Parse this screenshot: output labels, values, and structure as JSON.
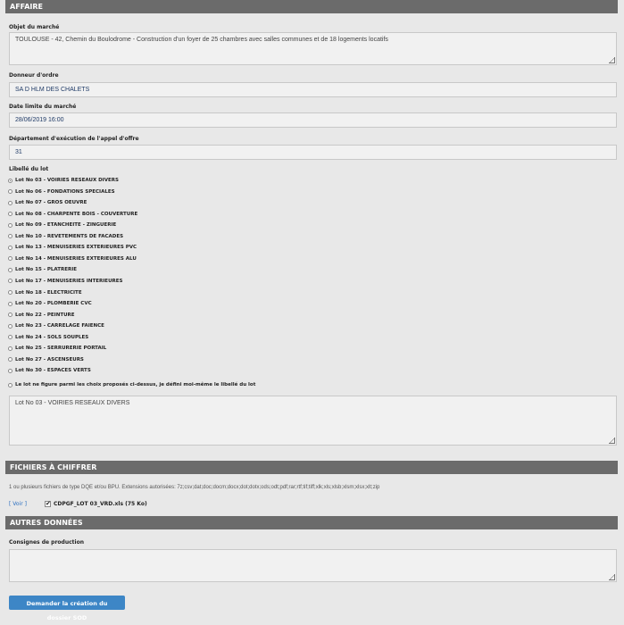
{
  "affaire": {
    "title": "AFFAIRE",
    "objet_label": "Objet du marché",
    "objet_value": "TOULOUSE - 42, Chemin du Boulodrome - Construction d'un foyer de 25 chambres avec salles communes et de 18 logements locatifs",
    "donneur_label": "Donneur d'ordre",
    "donneur_value": "SA D HLM DES CHALETS",
    "date_label": "Date limite du marché",
    "date_value": "28/06/2019 16:00",
    "departement_label": "Département d'exécution de l'appel d'offre",
    "departement_value": "31",
    "libelle_label": "Libellé du lot",
    "lots": [
      {
        "label": "Lot No 03 - VOIRIES RESEAUX DIVERS",
        "checked": true
      },
      {
        "label": "Lot No 06 - FONDATIONS SPECIALES",
        "checked": false
      },
      {
        "label": "Lot No 07 - GROS OEUVRE",
        "checked": false
      },
      {
        "label": "Lot No 08 - CHARPENTE BOIS - COUVERTURE",
        "checked": false
      },
      {
        "label": "Lot No 09 - ETANCHEITE - ZINGUERIE",
        "checked": false
      },
      {
        "label": "Lot No 10 - REVETEMENTS DE FACADES",
        "checked": false
      },
      {
        "label": "Lot No 13 - MENUISERIES EXTERIEURES PVC",
        "checked": false
      },
      {
        "label": "Lot No 14 - MENUISERIES EXTERIEURES ALU",
        "checked": false
      },
      {
        "label": "Lot No 15 - PLATRERIE",
        "checked": false
      },
      {
        "label": "Lot No 17 - MENUISERIES INTERIEURES",
        "checked": false
      },
      {
        "label": "Lot No 18 - ELECTRICITE",
        "checked": false
      },
      {
        "label": "Lot No 20 - PLOMBERIE CVC",
        "checked": false
      },
      {
        "label": "Lot No 22 - PEINTURE",
        "checked": false
      },
      {
        "label": "Lot No 23 - CARRELAGE FAIENCE",
        "checked": false
      },
      {
        "label": "Lot No 24 - SOLS SOUPLES",
        "checked": false
      },
      {
        "label": "Lot No 25 - SERRURERIE PORTAIL",
        "checked": false
      },
      {
        "label": "Lot No 27 - ASCENSEURS",
        "checked": false
      },
      {
        "label": "Lot No 30 - ESPACES VERTS",
        "checked": false
      }
    ],
    "custom_lot_label": "Le lot ne figure parmi les choix proposés ci-dessus, je défini moi-même le libellé du lot",
    "custom_lot_value": "Lot No 03 - VOIRIES RESEAUX DIVERS"
  },
  "fichiers": {
    "title": "FICHIERS À CHIFFRER",
    "description": "1 ou plusieurs fichiers de type DQE et/ou BPU. Extensions autorisées: 7z;csv;dat;doc;docm;docx;dot;dotx;ods;odt;pdf;rar;rtf;tif;tiff;xlk;xls;xlsb;xlsm;xlsx;xlt;zip",
    "voir_label": "[ Voir ]",
    "file_label": "CDPGF_LOT 03_VRD.xls (75 Ko)",
    "file_checked": true
  },
  "autres": {
    "title": "AUTRES DONNÉES",
    "consignes_label": "Consignes de production",
    "consignes_value": ""
  },
  "submit_label": "Demander la création du dossier SOD"
}
